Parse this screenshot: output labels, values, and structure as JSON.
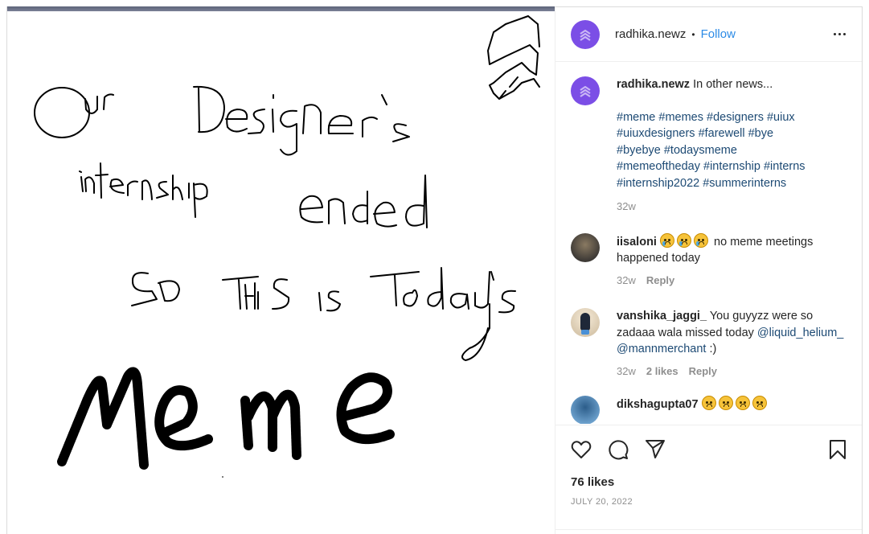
{
  "post": {
    "author": "radhika.newz",
    "separator": "•",
    "follow_label": "Follow",
    "more_icon": "more-options-icon",
    "brand_color": "#7b4ee6",
    "link_color": "#2c8be6"
  },
  "media": {
    "handwritten_lines": [
      "Our Designer's",
      "internship",
      "ended",
      "So This is Today's",
      "Meme"
    ]
  },
  "caption": {
    "username": "radhika.newz",
    "text": "In other news...",
    "hashtags_lines": [
      "#meme #memes #designers #uiux",
      "#uiuxdesigners #farewell #bye",
      "#byebye #todaysmeme",
      "#memeoftheday #internship #interns",
      "#internship2022 #summerinterns"
    ],
    "time": "32w"
  },
  "comments": [
    {
      "username": "iisaloni",
      "emojis": [
        "crying-face",
        "crying-face",
        "crying-face"
      ],
      "text": "no meme meetings happened today",
      "time": "32w",
      "likes": "",
      "reply_label": "Reply"
    },
    {
      "username": "vanshika_jaggi_",
      "text": "You guyyzz were so zadaaa wala missed today",
      "mentions": [
        "@liquid_helium_",
        "@mannmerchant"
      ],
      "trailing": ":)",
      "time": "32w",
      "likes": "2 likes",
      "reply_label": "Reply"
    },
    {
      "username": "dikshagupta07",
      "emojis": [
        "frowning-face",
        "frowning-face",
        "frowning-face",
        "frowning-face"
      ]
    }
  ],
  "actions": {
    "like_icon": "heart-icon",
    "comment_icon": "comment-icon",
    "share_icon": "send-icon",
    "save_icon": "bookmark-icon",
    "likes_count": "76 likes",
    "date": "JULY 20, 2022"
  }
}
